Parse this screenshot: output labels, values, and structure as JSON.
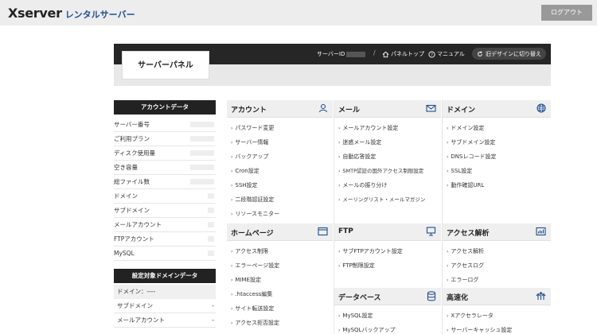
{
  "header": {
    "logo_main": "Xserver",
    "logo_sub": "レンタルサーバー",
    "logout_label": "ログアウト"
  },
  "panel": {
    "title": "サーバーパネル",
    "server_id_label": "サーバーID",
    "links": {
      "panel_top": "パネルトップ",
      "manual": "マニュアル",
      "old_design": "旧デザインに切り替え"
    }
  },
  "sidebar": {
    "account_title": "アカウントデータ",
    "account_rows": [
      {
        "label": "サーバー番号",
        "value": ""
      },
      {
        "label": "ご利用プラン",
        "value": ""
      },
      {
        "label": "ディスク使用量",
        "value": ""
      },
      {
        "label": "空き容量",
        "value": ""
      },
      {
        "label": "総ファイル数",
        "value": ""
      },
      {
        "label": "ドメイン",
        "value": ""
      },
      {
        "label": "サブドメイン",
        "value": ""
      },
      {
        "label": "メールアカウント",
        "value": ""
      },
      {
        "label": "FTPアカウント",
        "value": ""
      },
      {
        "label": "MySQL",
        "value": ""
      }
    ],
    "domain_title": "設定対象ドメインデータ",
    "domain_row": "ドメイン：----",
    "domain_rows": [
      {
        "label": "サブドメイン",
        "value": "-"
      },
      {
        "label": "メールアカウント",
        "value": "-"
      }
    ]
  },
  "categories": {
    "account": {
      "title": "アカウント",
      "items": [
        "パスワード変更",
        "サーバー情報",
        "バックアップ",
        "Cron設定",
        "SSH設定",
        "二段階認証設定",
        "リソースモニター"
      ]
    },
    "mail": {
      "title": "メール",
      "items": [
        "メールアカウント設定",
        "迷惑メール設定",
        "自動応答設定",
        "SMTP認証の国外アクセス制限設定",
        "メールの振り分け",
        "メーリングリスト・メールマガジン"
      ]
    },
    "domain": {
      "title": "ドメイン",
      "items": [
        "ドメイン設定",
        "サブドメイン設定",
        "DNSレコード設定",
        "SSL設定",
        "動作確認URL"
      ]
    },
    "homepage": {
      "title": "ホームページ",
      "items": [
        "アクセス制限",
        "エラーページ設定",
        "MIME設定",
        ".htaccess編集",
        "サイト転送設定",
        "アクセス拒否設定"
      ]
    },
    "ftp": {
      "title": "FTP",
      "items": [
        "サブFTPアカウント設定",
        "FTP制限設定"
      ]
    },
    "analytics": {
      "title": "アクセス解析",
      "items": [
        "アクセス解析",
        "アクセスログ",
        "エラーログ"
      ]
    },
    "database": {
      "title": "データベース",
      "items": [
        "MySQL設定",
        "MySQLバックアップ"
      ]
    },
    "speed": {
      "title": "高速化",
      "items": [
        "Xアクセラレータ",
        "サーバーキャッシュ設定"
      ]
    }
  },
  "colors": {
    "accent": "#1d4f91",
    "dark": "#262626"
  }
}
